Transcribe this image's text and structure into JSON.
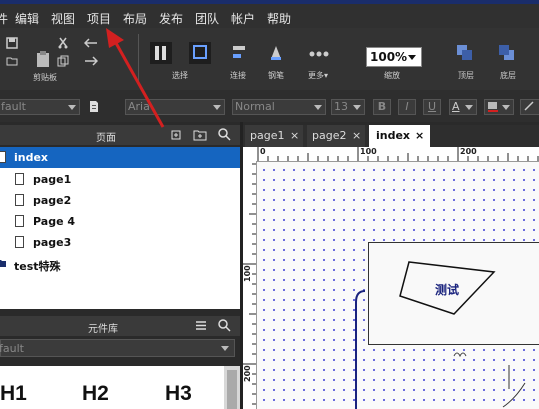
{
  "menu": [
    "件",
    "编辑",
    "视图",
    "项目",
    "布局",
    "发布",
    "团队",
    "帐户",
    "帮助"
  ],
  "toolbar": {
    "clipboard_label": "剪贴板",
    "select_label": "选择",
    "connect_label": "连接",
    "pen_label": "钢笔",
    "more_label": "更多▾",
    "zoom_value": "100%",
    "zoom_label": "缩放",
    "top_label": "顶层",
    "bottom_label": "底层"
  },
  "format": {
    "style_value": "fault",
    "font_value": "Aria",
    "weight_value": "Normal",
    "size_value": "13",
    "bold": "B",
    "italic": "I",
    "underline": "U",
    "font_color": "A"
  },
  "pages_panel": {
    "title": "页面",
    "items": [
      "index",
      "page1",
      "page2",
      "Page 4",
      "page3",
      "test特殊"
    ]
  },
  "library_panel": {
    "title": "元件库",
    "selected": "fault",
    "headings": [
      "H1",
      "H2",
      "H3"
    ]
  },
  "tabs": [
    {
      "label": "page1",
      "close": "×"
    },
    {
      "label": "page2",
      "close": "×"
    },
    {
      "label": "index",
      "close": "×"
    }
  ],
  "rulers": {
    "h": [
      "0",
      "100",
      "200"
    ],
    "v": [
      "100",
      "200"
    ]
  },
  "canvas": {
    "shape_text": "测试"
  },
  "colors": {
    "selected_row": "#1565c0",
    "arrow": "#d32020",
    "grid_dot": "#3b3bd6"
  }
}
